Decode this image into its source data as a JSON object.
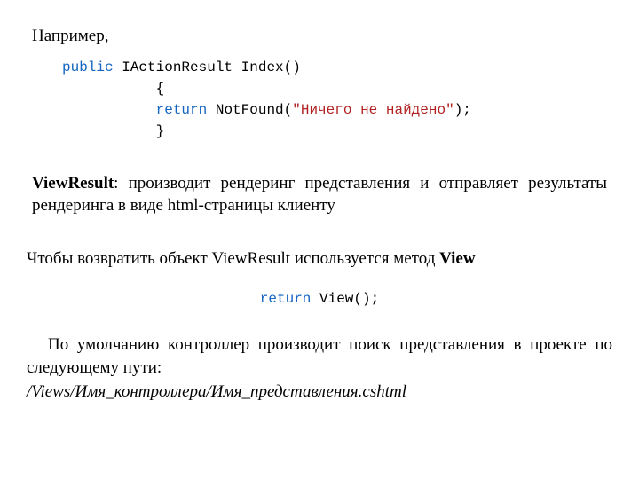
{
  "intro": "Например,",
  "code": {
    "kw_public": "public",
    "sig": " IActionResult Index()",
    "brace_open": "           {",
    "kw_return": "return",
    "notfound_call": " NotFound(",
    "str_literal": "\"Ничего не найдено\"",
    "call_end": ");",
    "brace_close": "           }"
  },
  "view_desc": {
    "bold": "ViewResult",
    "rest": ": производит рендеринг представления и отправляет результаты рендеринга в виде html-страницы клиенту"
  },
  "view_usage": {
    "prefix": "Чтобы возвратить объект ViewResult используется метод ",
    "bold": "View"
  },
  "codeline": {
    "kw_return": "return",
    "rest": " View();"
  },
  "default_path": "По умолчанию контроллер производит поиск представления в проекте по следующему пути:",
  "italic_path": "/Views/Имя_контроллера/Имя_представления.cshtml"
}
